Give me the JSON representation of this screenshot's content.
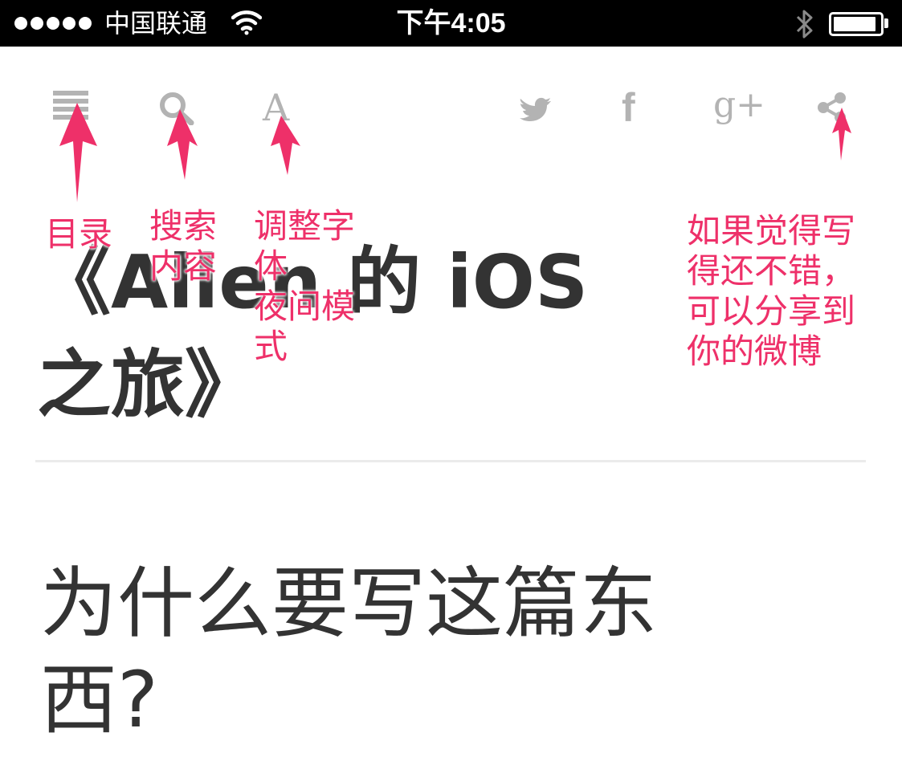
{
  "status_bar": {
    "carrier": "中国联通",
    "time": "下午4:05",
    "battery_level": 0.92
  },
  "toolbar": {
    "icons": [
      "menu-icon",
      "search-icon",
      "font-icon",
      "twitter-icon",
      "facebook-icon",
      "google-plus-icon",
      "share-icon"
    ],
    "font_glyph": "A",
    "facebook_glyph": "f",
    "google_plus_glyph": "g+"
  },
  "article": {
    "title": "《Allen 的 iOS 之旅》",
    "section_heading": "为什么要写这篇东西?"
  },
  "annotations": {
    "menu": "目录",
    "search": "搜索\n内容",
    "font": "调整字\n体\n夜间模\n式",
    "share": "如果觉得写\n得还不错，\n可以分享到\n你的微博"
  },
  "colors": {
    "annotation": "#ee3069",
    "icon": "#b3b3b3",
    "text": "#333333",
    "status_bar": "#000000"
  }
}
